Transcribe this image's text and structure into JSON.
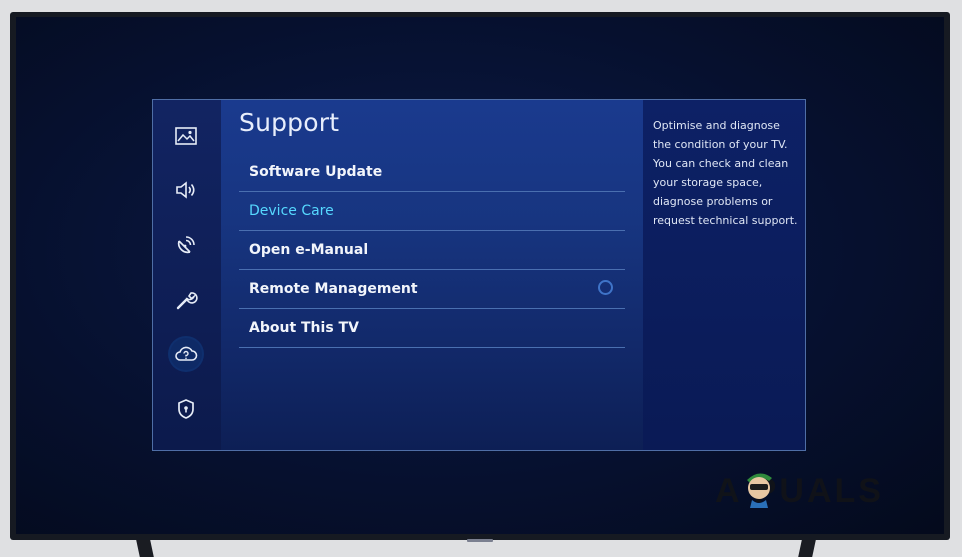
{
  "menu": {
    "title": "Support",
    "items": [
      {
        "label": "Software Update"
      },
      {
        "label": "Device Care"
      },
      {
        "label": "Open e-Manual"
      },
      {
        "label": "Remote Management"
      },
      {
        "label": "About This TV"
      }
    ]
  },
  "sidebar": {
    "icons": [
      "picture-icon",
      "sound-icon",
      "broadcasting-icon",
      "general-icon",
      "support-icon",
      "privacy-icon"
    ],
    "active": "support-icon"
  },
  "description": "Optimise and diagnose the condition of your TV. You can check and clean your storage space, diagnose problems or request technical support.",
  "watermark": "A PUALS",
  "colors": {
    "highlight_text": "#56d9ff",
    "panel_bg": "#173580",
    "divider": "#4a6fb0"
  }
}
